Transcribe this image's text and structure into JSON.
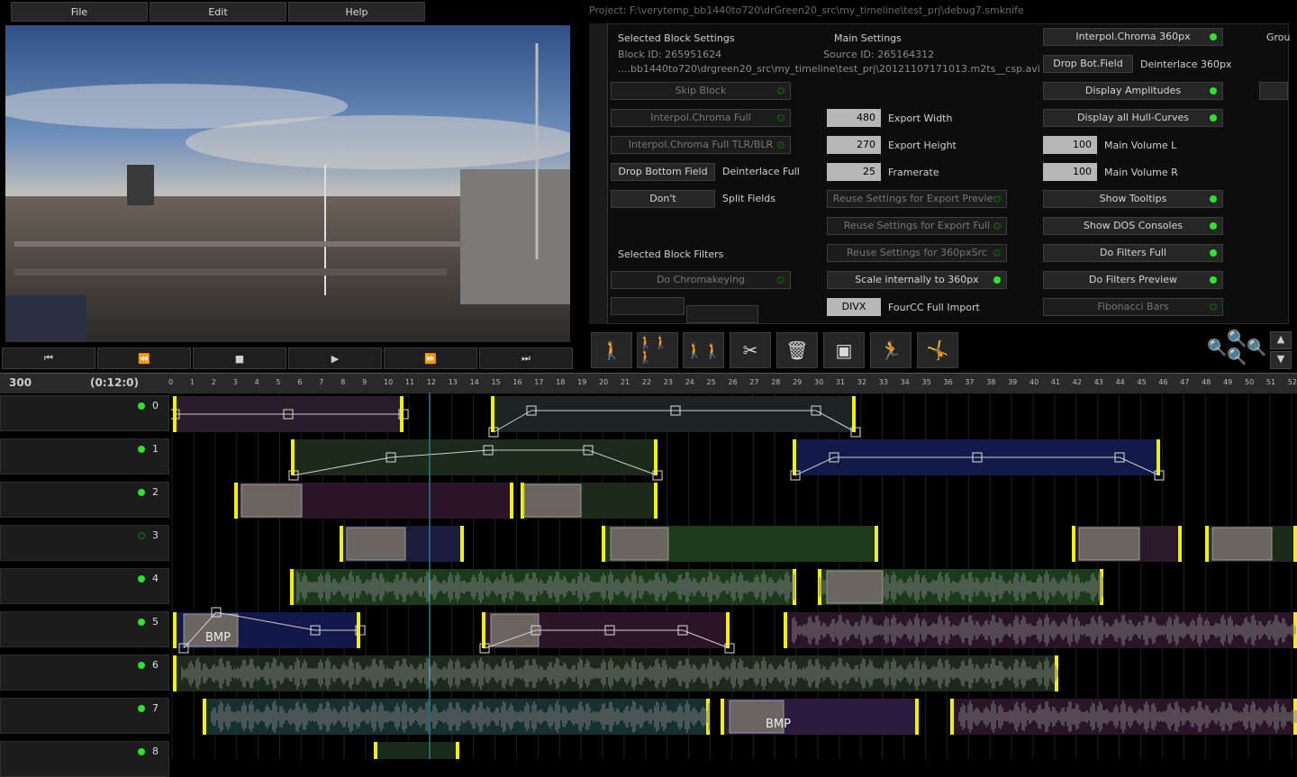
{
  "menu": {
    "file": "File",
    "edit": "Edit",
    "help": "Help"
  },
  "project_path": "Project: F:\\verytemp_bb1440to720\\drGreen20_src\\my_timeline\\test_prj\\debug7.smknife",
  "block_settings": {
    "title": "Selected Block Settings",
    "block_id": "Block ID: 265951624",
    "main_title": "Main Settings",
    "source_id": "Source ID: 265164312",
    "source_path": "....bb1440to720\\drgreen20_src\\my_timeline\\test_prj\\20121107171013.m2ts__csp.avi",
    "skip_block": "Skip Block",
    "interpol_full": "Interpol.Chroma Full",
    "interpol_full_tlr": "Interpol.Chroma Full TLR/BLR",
    "drop_bottom": "Drop Bottom Field",
    "deinterlace_full": "Deinterlace Full",
    "dont": "Don't",
    "split_fields": "Split Fields",
    "filters_title": "Selected Block Filters",
    "chromakeying": "Do Chromakeying"
  },
  "export": {
    "width_val": "480",
    "width_label": "Export Width",
    "height_val": "270",
    "height_label": "Export Height",
    "fps_val": "25",
    "fps_label": "Framerate",
    "reuse_preview": "Reuse Settings for Export Preview",
    "reuse_full": "Reuse Settings for Export Full",
    "reuse_360": "Reuse Settings for 360pxSrc",
    "scale_360": "Scale internally to 360px",
    "fourcc_val": "DIVX",
    "fourcc_label": "FourCC Full Import"
  },
  "right": {
    "interpol_360": "Interpol.Chroma 360px",
    "group": "Grou",
    "drop_bot": "Drop Bot.Field",
    "deinterlace_360": "Deinterlace 360px",
    "display_amp": "Display Amplitudes",
    "display_hull": "Display all Hull-Curves",
    "vol_l_val": "100",
    "vol_l_label": "Main Volume L",
    "vol_r_val": "100",
    "vol_r_label": "Main Volume R",
    "tooltips": "Show Tooltips",
    "dos": "Show DOS Consoles",
    "filters_full": "Do Filters Full",
    "filters_preview": "Do Filters Preview",
    "fibonacci": "Fibonacci Bars"
  },
  "timeline": {
    "frame": "300",
    "time": "(0:12:0)",
    "ruler_labels": [
      "0",
      "1",
      "2",
      "3",
      "4",
      "5",
      "6",
      "7",
      "8",
      "9",
      "10",
      "11",
      "12",
      "13",
      "14",
      "15",
      "16",
      "17",
      "18",
      "19",
      "20",
      "21",
      "22",
      "23",
      "24",
      "25",
      "26",
      "27",
      "28",
      "29",
      "30",
      "31",
      "32",
      "33",
      "34",
      "35",
      "36",
      "37",
      "38",
      "39",
      "40",
      "41",
      "42",
      "43",
      "44",
      "45",
      "46",
      "47",
      "48",
      "49",
      "50",
      "51",
      "52"
    ],
    "tracks": [
      {
        "label": "0",
        "active": true
      },
      {
        "label": "1",
        "active": true
      },
      {
        "label": "2",
        "active": true
      },
      {
        "label": "3",
        "active": false
      },
      {
        "label": "4",
        "active": true
      },
      {
        "label": "5",
        "active": true
      },
      {
        "label": "6",
        "active": true
      },
      {
        "label": "7",
        "active": true
      },
      {
        "label": "8",
        "active": true
      }
    ],
    "bmp_label": "BMP"
  },
  "colors": {
    "led_on": "#2ee22e",
    "marker": "#f0f000",
    "playhead": "#2aa7c7",
    "range_marker": "#d02020"
  }
}
